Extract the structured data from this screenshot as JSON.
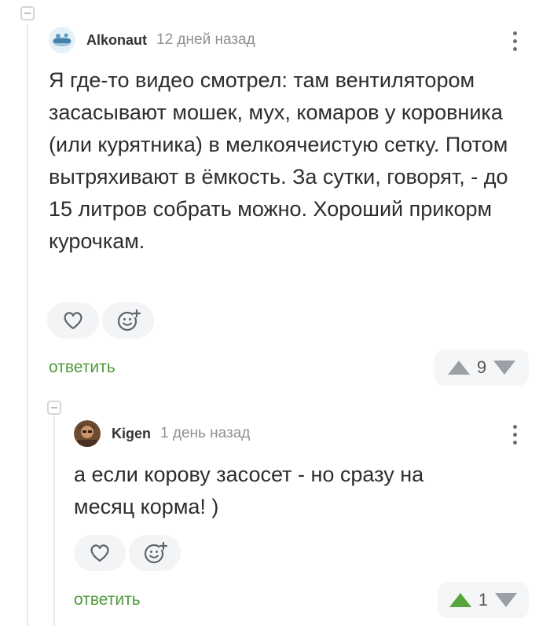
{
  "comments": [
    {
      "author": "Alkonaut",
      "time": "12 дней назад",
      "text": "Я где-то видео смотрел: там вентилятором засасывают мошек, мух, комаров у коровника (или курятника) в мелкоячеистую сетку. Потом вытряхивают в ёмкость. За сутки, говорят, - до 15 литров собрать можно. Хороший прикорм курочкам.",
      "reply_label": "ответить",
      "rating": "9",
      "upvoted": false
    },
    {
      "author": "Kigen",
      "time": "1 день назад",
      "text": "а если корову засосет - но сразу на месяц корма! )",
      "reply_label": "ответить",
      "rating": "1",
      "upvoted": true
    }
  ],
  "icons": {
    "like": "heart-icon",
    "emoji": "add-reaction-icon",
    "menu": "more-vertical-icon",
    "upvote": "arrow-up-icon",
    "downvote": "arrow-down-icon"
  },
  "colors": {
    "reply_link": "#4f9a3b",
    "upvote_active": "#57a53d",
    "vote_inactive": "#9aa0a6"
  }
}
